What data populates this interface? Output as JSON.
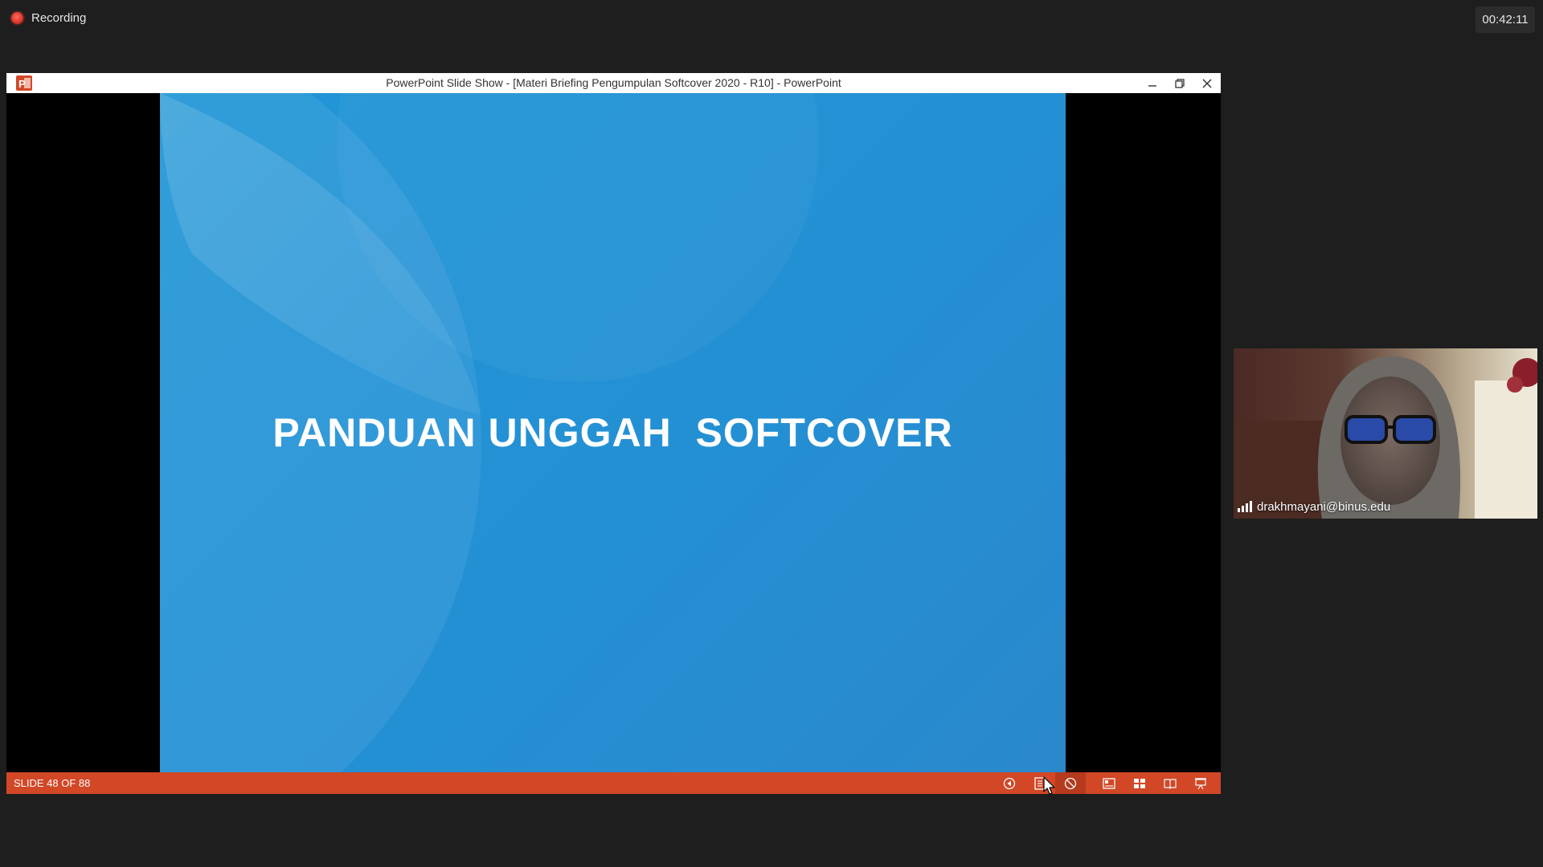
{
  "recording": {
    "label": "Recording"
  },
  "timer": {
    "value": "00:42:11"
  },
  "ppt_window": {
    "title": "PowerPoint Slide Show - [Materi Briefing Pengumpulan Softcover 2020 - R10] - PowerPoint",
    "controls": [
      "minimize",
      "restore",
      "close"
    ]
  },
  "slide": {
    "title": "PANDUAN UNGGAH  SOFTCOVER",
    "background_color": "#2196d6"
  },
  "statusbar": {
    "slide_counter": "SLIDE 48 OF 88",
    "accent_color": "#d24726",
    "icons": [
      "previous-icon",
      "notes-icon",
      "accessibility-icon",
      "normal-view-icon",
      "slide-sorter-icon",
      "reading-view-icon",
      "slide-show-icon"
    ]
  },
  "participant": {
    "name": "drakhmayani@binus.edu"
  }
}
